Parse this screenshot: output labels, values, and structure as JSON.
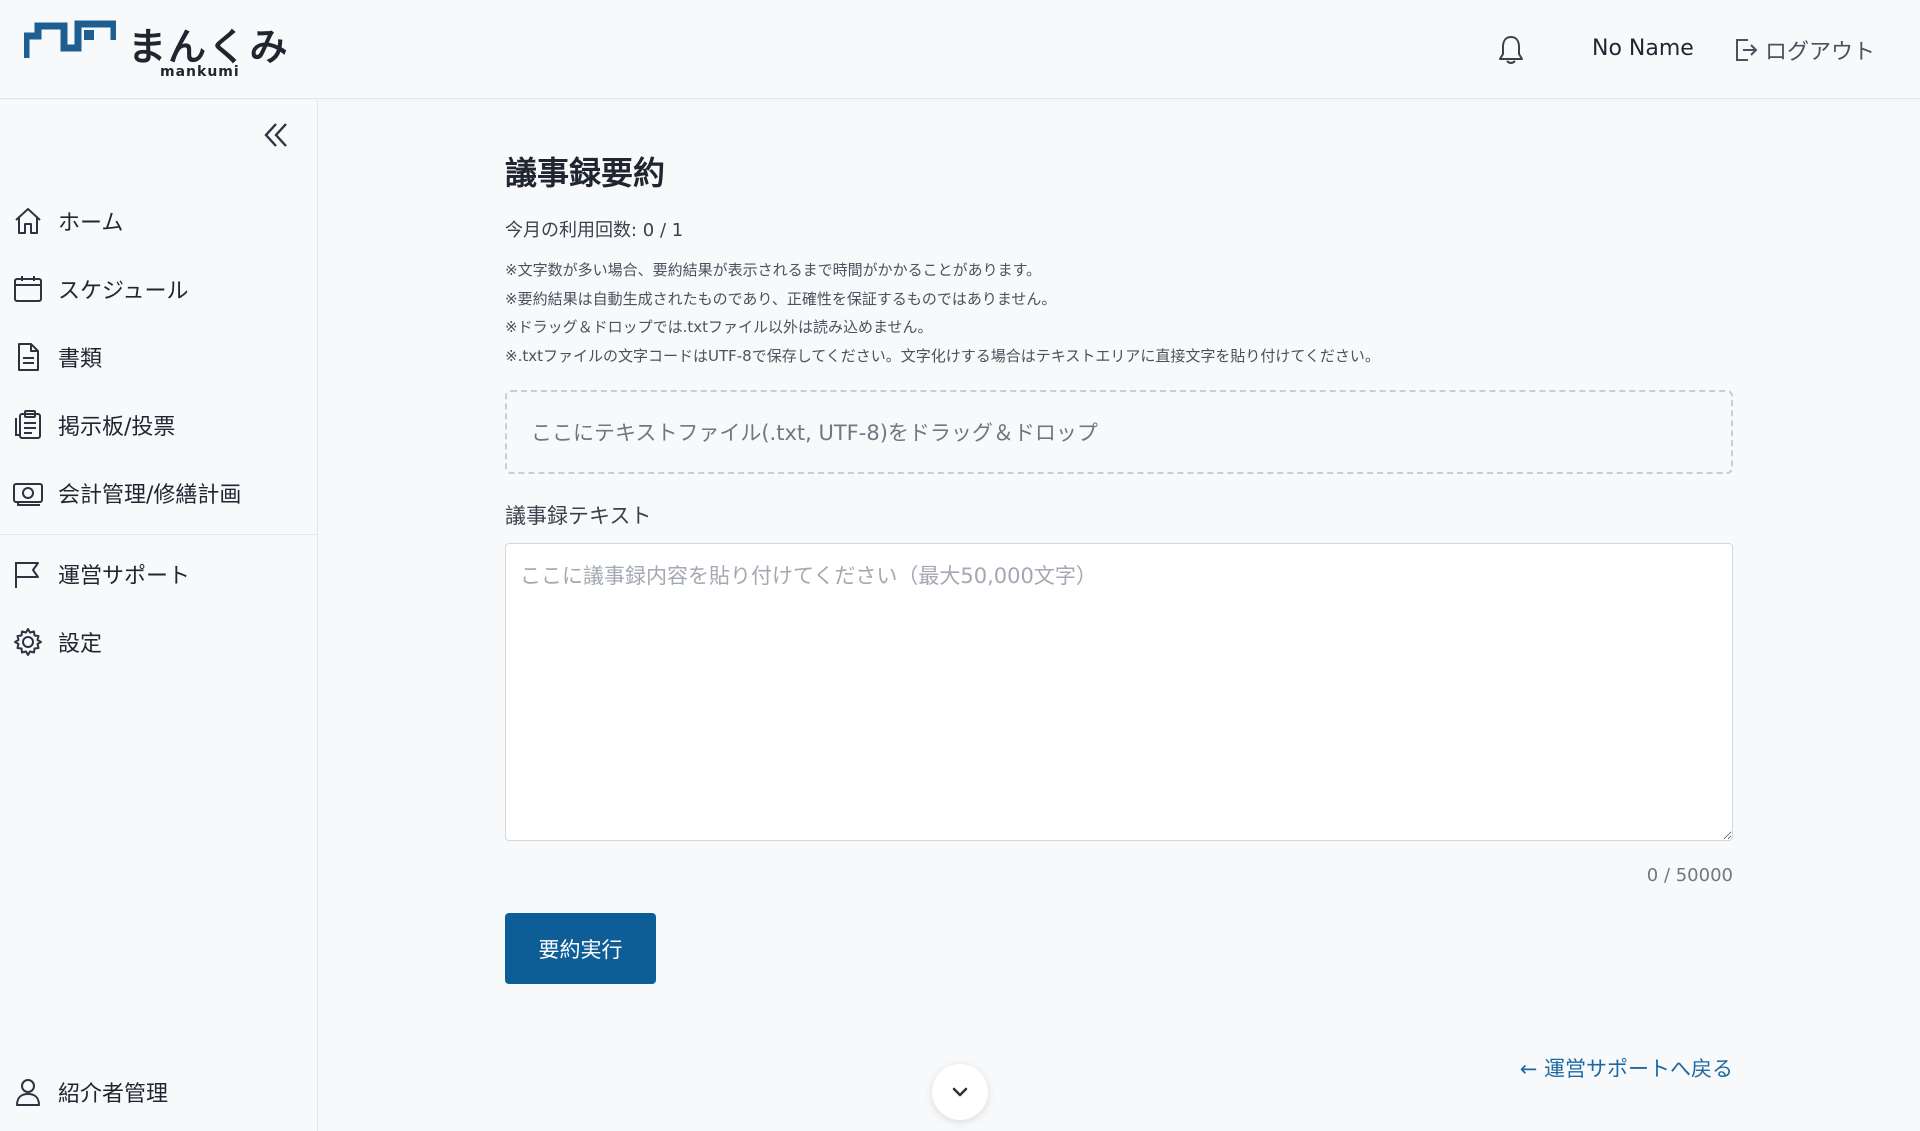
{
  "header": {
    "brand_name": "まんくみ",
    "brand_sub": "mankumi",
    "user_name": "No Name",
    "logout_label": "ログアウト",
    "brand_color": "#1d5f93"
  },
  "sidebar": {
    "items": [
      {
        "label": "ホーム",
        "icon": "home-icon"
      },
      {
        "label": "スケジュール",
        "icon": "calendar-icon"
      },
      {
        "label": "書類",
        "icon": "document-icon"
      },
      {
        "label": "掲示板/投票",
        "icon": "clipboard-icon"
      },
      {
        "label": "会計管理/修繕計画",
        "icon": "money-icon"
      },
      {
        "label": "運営サポート",
        "icon": "flag-icon"
      },
      {
        "label": "設定",
        "icon": "gear-icon"
      },
      {
        "label": "紹介者管理",
        "icon": "user-icon"
      }
    ]
  },
  "main": {
    "title": "議事録要約",
    "usage": "今月の利用回数: 0 / 1",
    "notes": [
      "※文字数が多い場合、要約結果が表示されるまで時間がかかることがあります。",
      "※要約結果は自動生成されたものであり、正確性を保証するものではありません。",
      "※ドラッグ＆ドロップでは.txtファイル以外は読み込めません。",
      "※.txtファイルの文字コードはUTF-8で保存してください。文字化けする場合はテキストエリアに直接文字を貼り付けてください。"
    ],
    "dropzone_text": "ここにテキストファイル(.txt, UTF-8)をドラッグ＆ドロップ",
    "textarea_label": "議事録テキスト",
    "textarea_placeholder": "ここに議事録内容を貼り付けてください（最大50,000文字）",
    "textarea_value": "",
    "counter": "0 / 50000",
    "submit_label": "要約実行",
    "back_link": "← 運営サポートへ戻る",
    "primary_color": "#0d5d96"
  }
}
